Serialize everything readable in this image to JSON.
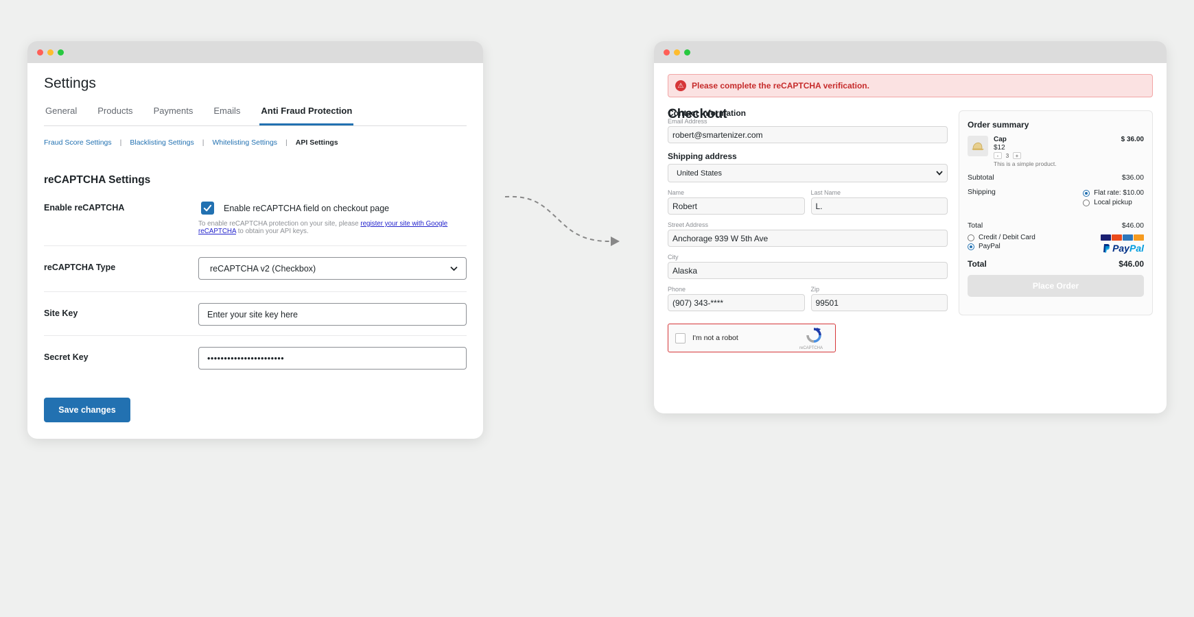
{
  "settings": {
    "title": "Settings",
    "tabs": [
      "General",
      "Products",
      "Payments",
      "Emails",
      "Anti Fraud Protection"
    ],
    "subnav": {
      "fraud_score": "Fraud Score Settings",
      "blacklisting": "Blacklisting Settings",
      "whitelisting": "Whitelisting Settings",
      "api": "API Settings",
      "separator": "|"
    },
    "section_title": "reCAPTCHA Settings",
    "enable": {
      "label": "Enable reCAPTCHA",
      "checkbox_label": "Enable reCAPTCHA field on checkout page",
      "checked": true,
      "help_prefix": "To enable reCAPTCHA protection on your site, please ",
      "help_link": "register your site with Google reCAPTCHA",
      "help_suffix": " to obtain your API keys."
    },
    "type": {
      "label": "reCAPTCHA Type",
      "value": "reCAPTCHA v2 (Checkbox)"
    },
    "site_key": {
      "label": "Site Key",
      "placeholder": "Enter your site key here"
    },
    "secret_key": {
      "label": "Secret Key",
      "value": "•••••••••••••••••••••••"
    },
    "save_label": "Save changes"
  },
  "checkout": {
    "alert": "Please complete the reCAPTCHA verification.",
    "title": "Checkout",
    "contact_heading": "Contact Information",
    "email_label": "Email Address",
    "email_value": "robert@smartenizer.com",
    "shipping_heading": "Shipping address",
    "country": "United States",
    "name_label": "Name",
    "name_value": "Robert",
    "last_label": "Last Name",
    "last_value": "L.",
    "street_label": "Street Address",
    "street_value": "Anchorage 939 W 5th Ave",
    "city_label": "City",
    "city_value": "Alaska",
    "phone_label": "Phone",
    "phone_value": "(907) 343-****",
    "zip_label": "Zip",
    "zip_value": "99501",
    "recaptcha_text": "I'm not a robot",
    "recaptcha_brand": "reCAPTCHA"
  },
  "summary": {
    "title": "Order summary",
    "item": {
      "name": "Cap",
      "unit_price": "$12",
      "qty": "3",
      "qty_minus": "-",
      "qty_plus": "+",
      "desc": "This is a simple product.",
      "price": "$ 36.00"
    },
    "subtotal_label": "Subtotal",
    "subtotal_value": "$36.00",
    "shipping_label": "Shipping",
    "shipping_options": [
      "Flat rate: $10.00",
      "Local pickup"
    ],
    "shipping_selected": 0,
    "total_label": "Total",
    "total_value": "$46.00",
    "payment_options": [
      "Credit / Debit Card",
      "PayPal"
    ],
    "payment_selected": 1,
    "paypal_a": "Pay",
    "paypal_b": "Pal",
    "grand_total_label": "Total",
    "grand_total_value": "$46.00",
    "place_order": "Place Order"
  },
  "colors": {
    "accent": "#2271b1",
    "error": "#d63638",
    "error_bg": "#fbe2e2"
  }
}
